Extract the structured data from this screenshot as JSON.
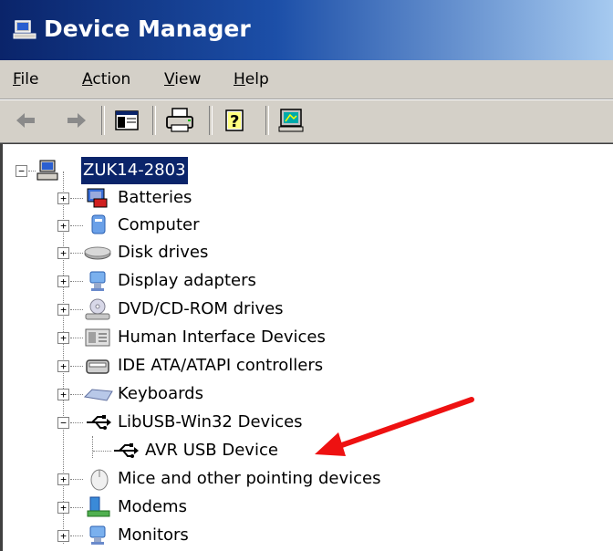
{
  "window": {
    "title": "Device Manager"
  },
  "menu": [
    {
      "label": "File",
      "u": "F",
      "rest": "ile"
    },
    {
      "label": "Action",
      "u": "A",
      "rest": "ction"
    },
    {
      "label": "View",
      "u": "V",
      "rest": "iew"
    },
    {
      "label": "Help",
      "u": "H",
      "rest": "elp"
    }
  ],
  "toolbar": {
    "icons": [
      "back-icon",
      "forward-icon",
      "show-hide-console-tree-icon",
      "print-icon",
      "help-icon",
      "properties-icon"
    ]
  },
  "tree": {
    "root": "ZUK14-2803",
    "items": [
      {
        "label": "Batteries",
        "icon": "battery-icon"
      },
      {
        "label": "Computer",
        "icon": "computer-icon"
      },
      {
        "label": "Disk drives",
        "icon": "disk-drive-icon"
      },
      {
        "label": "Display adapters",
        "icon": "display-adapter-icon"
      },
      {
        "label": "DVD/CD-ROM drives",
        "icon": "dvd-drive-icon"
      },
      {
        "label": "Human Interface Devices",
        "icon": "hid-icon"
      },
      {
        "label": "IDE ATA/ATAPI controllers",
        "icon": "ide-controller-icon"
      },
      {
        "label": "Keyboards",
        "icon": "keyboard-icon"
      },
      {
        "label": "LibUSB-Win32 Devices",
        "icon": "usb-icon",
        "expanded": true
      },
      {
        "label": "AVR USB Device",
        "icon": "usb-icon",
        "child": true
      },
      {
        "label": "Mice and other pointing devices",
        "icon": "mouse-icon"
      },
      {
        "label": "Modems",
        "icon": "modem-icon"
      },
      {
        "label": "Monitors",
        "icon": "monitor-icon"
      }
    ]
  },
  "annotation": {
    "color": "#ee1111"
  }
}
